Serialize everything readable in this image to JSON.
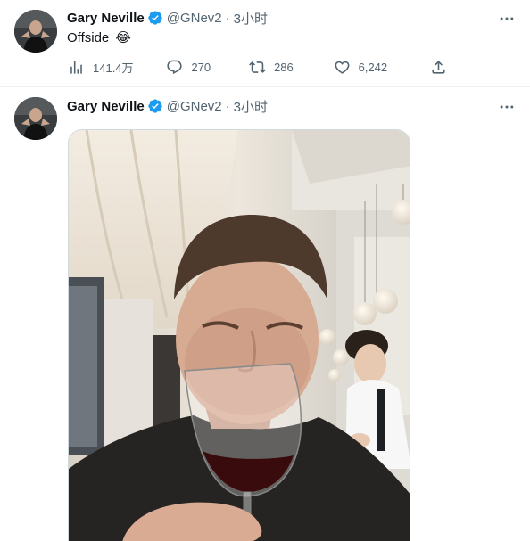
{
  "tweets": [
    {
      "author": {
        "name": "Gary Neville",
        "handle": "@GNev2",
        "verified": true
      },
      "separator": "·",
      "time": "3小时",
      "text": "Offside",
      "emoji": "😂",
      "stats": {
        "views": "141.4万",
        "replies": "270",
        "retweets": "286",
        "likes": "6,242"
      }
    },
    {
      "author": {
        "name": "Gary Neville",
        "handle": "@GNev2",
        "verified": true
      },
      "separator": "·",
      "time": "3小时"
    }
  ],
  "colors": {
    "verified": "#1d9bf0",
    "secondary_text": "#536471",
    "divider": "#eff3f4"
  },
  "icons": {
    "views": "bar-chart-icon",
    "reply": "speech-bubble-icon",
    "retweet": "retweet-icon",
    "like": "heart-icon",
    "share": "upload-icon",
    "more": "more-dots-icon"
  }
}
